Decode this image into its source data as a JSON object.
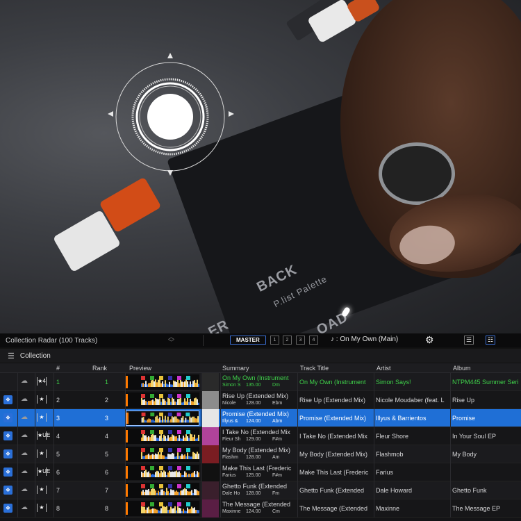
{
  "topbar": {
    "radar_title": "Collection Radar (100 Tracks)",
    "master_label": "MASTER",
    "decks": [
      "1",
      "2",
      "3",
      "4"
    ],
    "now_playing": "On My Own (Main)"
  },
  "collection_bar": {
    "label": "Collection"
  },
  "table": {
    "columns": {
      "number": "#",
      "rank": "Rank",
      "preview": "Preview",
      "summary": "Summary",
      "track_title": "Track Title",
      "artist": "Artist",
      "album": "Album"
    },
    "rows": [
      {
        "num": "1",
        "rank": "1",
        "summary_title": "On My Own (Instrument",
        "summary_artist": "Simon S",
        "bpm": "135.00",
        "key": "Dm",
        "title": "On My Own (Instrument",
        "artist": "Simon Says!",
        "album": "NTPM445 Summer Seri",
        "star_label": "4",
        "state": "playing",
        "art_color": "#2a2a2a"
      },
      {
        "num": "2",
        "rank": "2",
        "summary_title": "Rise Up (Extended Mix)",
        "summary_artist": "Nicole",
        "bpm": "128.00",
        "key": "Ebm",
        "title": "Rise Up (Extended Mix)",
        "artist": "Nicole Moudaber (feat. L",
        "album": "Rise Up",
        "star_label": "",
        "state": "normal",
        "art_color": "#8c8c8c"
      },
      {
        "num": "3",
        "rank": "3",
        "summary_title": "Promise (Extended Mix)",
        "summary_artist": "Illyus &",
        "bpm": "124.00",
        "key": "Abm",
        "title": "Promise (Extended Mix)",
        "artist": "Illyus & Barrientos",
        "album": "Promise",
        "star_label": "",
        "state": "selected",
        "art_color": "#e6e6e6"
      },
      {
        "num": "4",
        "rank": "4",
        "summary_title": "I Take No (Extended Mix",
        "summary_artist": "Fleur Sh",
        "bpm": "129.00",
        "key": "F#m",
        "title": "I Take No (Extended Mix",
        "artist": "Fleur Shore",
        "album": "In Your Soul EP",
        "star_label": "UE",
        "state": "normal",
        "art_color": "#b0439a"
      },
      {
        "num": "5",
        "rank": "5",
        "summary_title": "My Body (Extended Mix)",
        "summary_artist": "Flashm",
        "bpm": "128.00",
        "key": "Am",
        "title": "My Body (Extended Mix)",
        "artist": "Flashmob",
        "album": "My Body",
        "star_label": "",
        "state": "normal",
        "art_color": "#7a1d22"
      },
      {
        "num": "6",
        "rank": "6",
        "summary_title": "Make This Last (Frederic",
        "summary_artist": "Farius",
        "bpm": "125.00",
        "key": "F#m",
        "title": "Make This Last (Frederic",
        "artist": "Farius",
        "album": "",
        "star_label": "UE",
        "state": "normal",
        "art_color": "#111111"
      },
      {
        "num": "7",
        "rank": "7",
        "summary_title": "Ghetto Funk (Extended",
        "summary_artist": "Dale Ho",
        "bpm": "128.00",
        "key": "Fm",
        "title": "Ghetto Funk (Extended",
        "artist": "Dale Howard",
        "album": "Ghetto Funk",
        "star_label": "",
        "state": "normal",
        "art_color": "#3a1f2c"
      },
      {
        "num": "8",
        "rank": "8",
        "summary_title": "The Message (Extended",
        "summary_artist": "Maxinne",
        "bpm": "124.00",
        "key": "Cm",
        "title": "The Message (Extended",
        "artist": "Maxinne",
        "album": "The Message EP",
        "star_label": "",
        "state": "normal",
        "art_color": "#5a1e44"
      }
    ]
  },
  "colors": {
    "selected_row": "#1f6fd6",
    "playing_text": "#3fd24a",
    "accent_blue": "#3b6fd4"
  },
  "icons": {
    "source": "dropbox-icon",
    "cloud": "cloud-icon",
    "rating": "star-icon",
    "settings": "gear-icon",
    "now_playing": "music-note-icon",
    "menu": "hamburger-icon"
  }
}
